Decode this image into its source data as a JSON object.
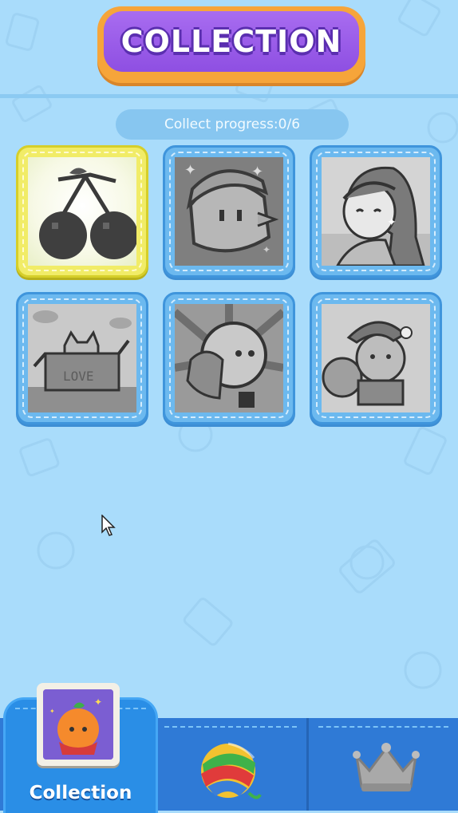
{
  "header": {
    "title": "COLLECTION"
  },
  "progress": {
    "label": "Collect progress:0/6"
  },
  "collection": {
    "items": [
      {
        "name": "cherries",
        "state": "unlocked",
        "icon": "cherry-icon"
      },
      {
        "name": "kirby",
        "state": "locked",
        "icon": "kirby-icon"
      },
      {
        "name": "girl",
        "state": "locked",
        "icon": "girl-icon"
      },
      {
        "name": "cat-box",
        "state": "locked",
        "icon": "cat-box-icon",
        "box_text": "LOVE"
      },
      {
        "name": "sun-character",
        "state": "locked",
        "icon": "sun-character-icon"
      },
      {
        "name": "dog-santa",
        "state": "locked",
        "icon": "dog-santa-icon"
      }
    ]
  },
  "nav": {
    "tabs": [
      {
        "id": "collection",
        "label": "Collection",
        "icon": "orange-character-icon",
        "active": true
      },
      {
        "id": "yarn",
        "label": "",
        "icon": "yarn-ball-icon",
        "active": false
      },
      {
        "id": "ranking",
        "label": "",
        "icon": "crown-icon",
        "active": false
      }
    ]
  },
  "colors": {
    "background": "#a9dcfb",
    "title_purple": "#9a5ce8",
    "title_orange": "#f6a53a",
    "card_blue": "#6cb9ef",
    "card_active": "#f1ec67",
    "nav_blue": "#2f7ad6"
  }
}
